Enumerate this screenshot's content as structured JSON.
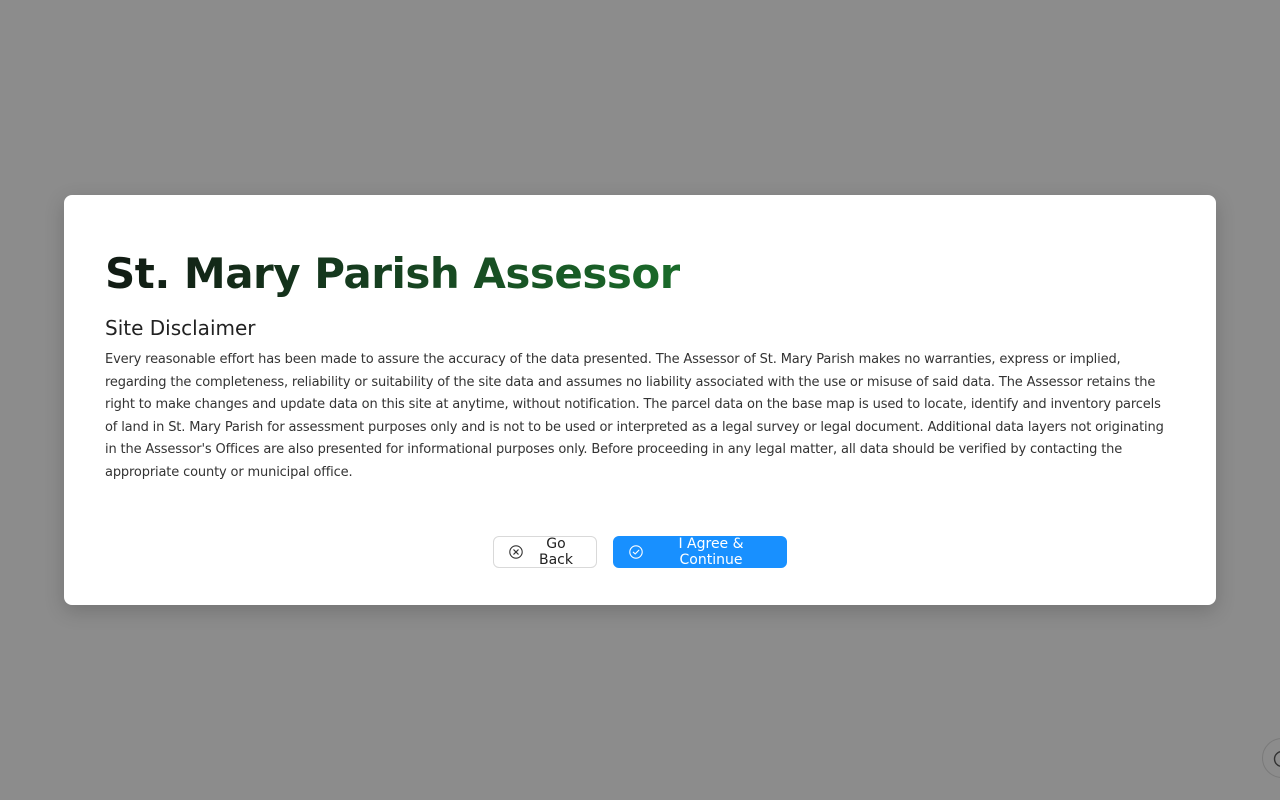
{
  "modal": {
    "title": "St. Mary Parish Assessor",
    "subtitle": "Site Disclaimer",
    "body": "Every reasonable effort has been made to assure the accuracy of the data presented. The Assessor of St. Mary Parish makes no warranties, express or implied, regarding the completeness, reliability or suitability of the site data and assumes no liability associated with the use or misuse of said data. The Assessor retains the right to make changes and update data on this site at anytime, without notification. The parcel data on the base map is used to locate, identify and inventory parcels of land in St. Mary Parish for assessment purposes only and is not to be used or interpreted as a legal survey or legal document. Additional data layers not originating in the Assessor's Offices are also presented for informational purposes only. Before proceeding in any legal matter, all data should be verified by contacting the appropriate county or municipal office.",
    "buttons": {
      "go_back": {
        "label": "Go Back",
        "icon": "close-circle-icon"
      },
      "agree": {
        "label": "I Agree & Continue",
        "icon": "check-circle-icon"
      }
    }
  },
  "corner_widget": {
    "icon": "help-circle-icon"
  },
  "colors": {
    "overlay": "#8c8c8c",
    "primary": "#1890ff",
    "title_gradient_start": "#111a13",
    "title_gradient_end": "#1a6b2a"
  }
}
